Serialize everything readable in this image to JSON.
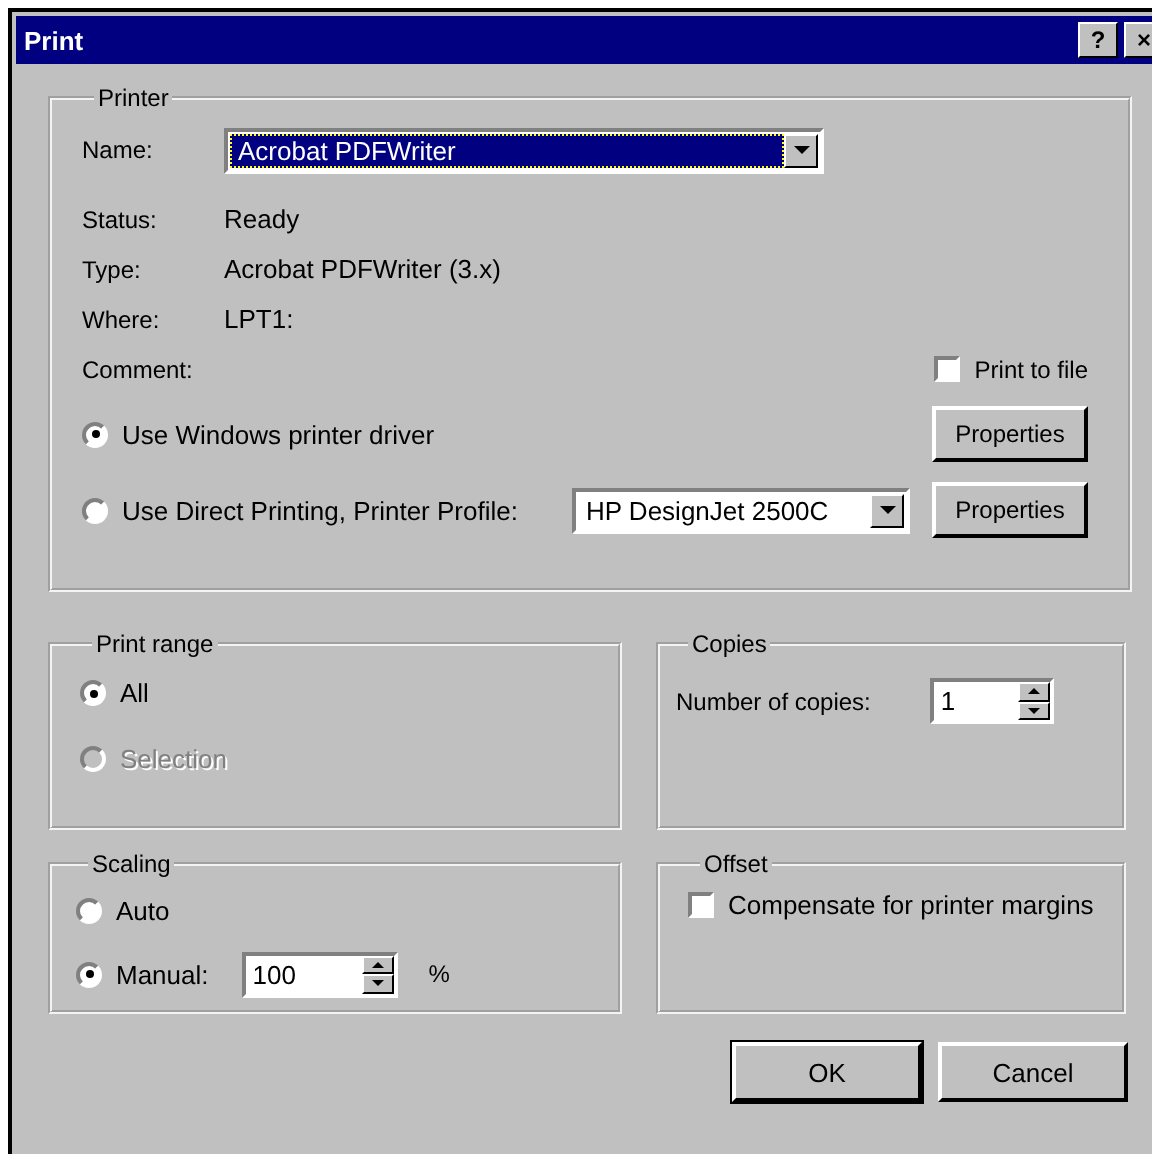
{
  "window": {
    "title": "Print",
    "title_buttons": [
      "?",
      "×"
    ]
  },
  "printer": {
    "title": "Printer",
    "name": {
      "label": "Name:",
      "value": "Acrobat PDFWriter",
      "focused": true
    },
    "info": [
      {
        "label": "Status:",
        "value": "Ready"
      },
      {
        "label": "Type:",
        "value": "Acrobat PDFWriter (3.x)"
      },
      {
        "label": "Where:",
        "value": "LPT1:"
      },
      {
        "label": "Comment:"
      }
    ],
    "print_to_file": {
      "label": "Print to file",
      "checked": false
    },
    "driver_options": [
      {
        "label": "Use Windows printer driver",
        "selected": true,
        "button": "Properties"
      },
      {
        "label": "Use Direct Printing, Printer Profile:",
        "selected": false,
        "profile": "HP DesignJet 2500C",
        "button": "Properties"
      }
    ]
  },
  "print_range": {
    "title": "Print range",
    "options": [
      {
        "label": "All",
        "selected": true,
        "disabled": false
      },
      {
        "label": "Selection",
        "selected": false,
        "disabled": true
      }
    ]
  },
  "copies": {
    "title": "Copies",
    "label": "Number of copies:",
    "value": "1"
  },
  "scaling": {
    "title": "Scaling",
    "options": [
      {
        "label": "Auto",
        "selected": false
      },
      {
        "label": "Manual:",
        "selected": true,
        "value": "100",
        "unit": "%"
      }
    ]
  },
  "offset": {
    "title": "Offset",
    "checkbox": {
      "label": "Compensate for printer margins",
      "checked": false
    }
  },
  "buttons": [
    {
      "label": "OK",
      "default": true
    },
    {
      "label": "Cancel",
      "default": false
    }
  ]
}
